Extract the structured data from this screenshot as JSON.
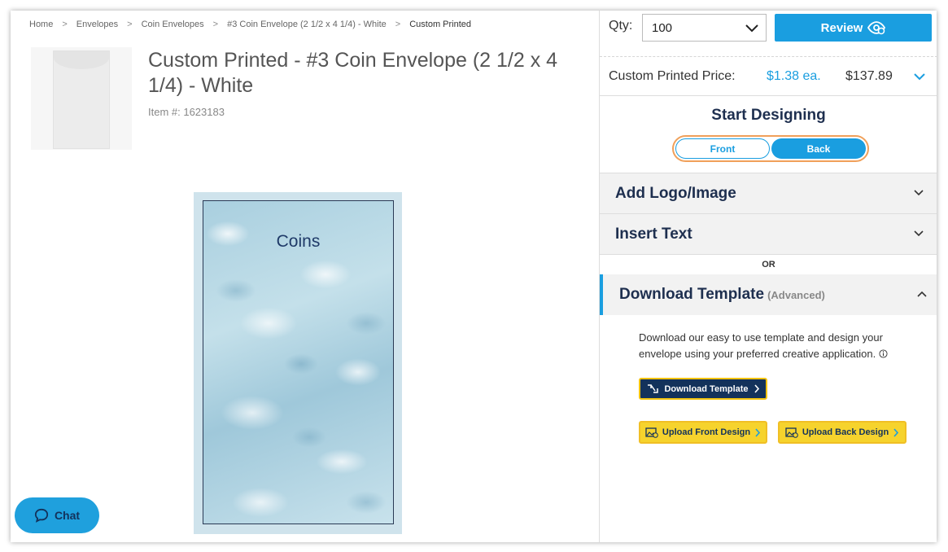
{
  "breadcrumb": {
    "items": [
      "Home",
      "Envelopes",
      "Coin Envelopes",
      "#3 Coin Envelope (2 1/2 x 4 1/4) - White",
      "Custom Printed"
    ],
    "separator": ">"
  },
  "product": {
    "title": "Custom Printed - #3 Coin Envelope (2 1/2 x 4 1/4) - White",
    "item_number": "Item #: 1623183"
  },
  "preview": {
    "text": "Coins"
  },
  "chat": {
    "label": "Chat"
  },
  "order": {
    "qty_label": "Qty:",
    "qty_value": "100",
    "review_label": "Review",
    "price_label": "Custom Printed Price:",
    "price_each": "$1.38 ea.",
    "price_total": "$137.89"
  },
  "design": {
    "title": "Start Designing",
    "front_label": "Front",
    "back_label": "Back",
    "selected_side": "Back"
  },
  "sections": {
    "add_logo": "Add Logo/Image",
    "insert_text": "Insert Text",
    "or": "OR",
    "download_template": "Download Template",
    "download_template_note": "(Advanced)"
  },
  "template": {
    "description": "Download our easy to use template and design your envelope using your preferred creative application.",
    "download_button": "Download Template",
    "upload_front_button": "Upload Front Design",
    "upload_back_button": "Upload Back Design"
  },
  "colors": {
    "accent_blue": "#1a9ee0",
    "navy": "#13325b",
    "yellow": "#f6d32d",
    "toggle_outline": "#f0a05a"
  }
}
